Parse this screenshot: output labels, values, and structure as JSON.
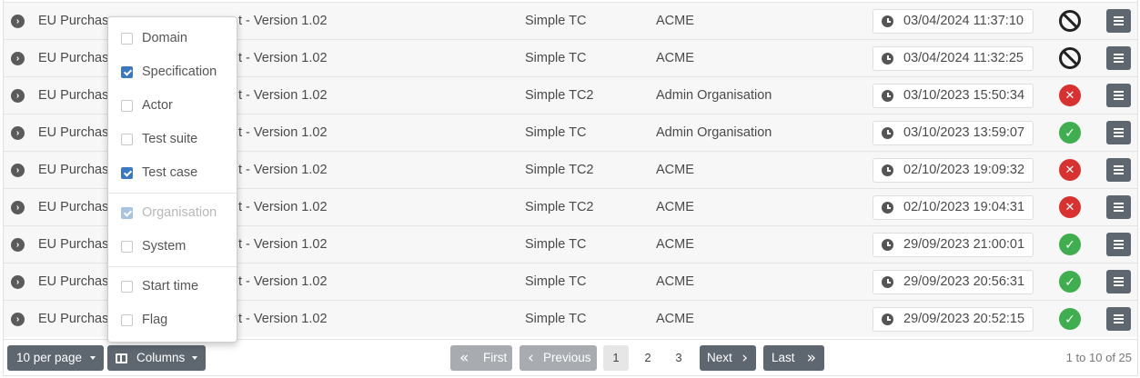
{
  "rows": [
    {
      "spec": "EU Purchase",
      "spec_suffix": "t - Version 1.02",
      "test_case": "Simple TC",
      "organisation": "ACME",
      "start_time": "03/04/2024 11:37:10",
      "status": "blocked",
      "status_icon": "ban-icon"
    },
    {
      "spec": "EU Purchase",
      "spec_suffix": "t - Version 1.02",
      "test_case": "Simple TC",
      "organisation": "ACME",
      "start_time": "03/04/2024 11:32:25",
      "status": "blocked",
      "status_icon": "ban-icon"
    },
    {
      "spec": "EU Purchase",
      "spec_suffix": "t - Version 1.02",
      "test_case": "Simple TC2",
      "organisation": "Admin Organisation",
      "start_time": "03/10/2023 15:50:34",
      "status": "failure",
      "status_icon": "x-circle-icon"
    },
    {
      "spec": "EU Purchase",
      "spec_suffix": "t - Version 1.02",
      "test_case": "Simple TC",
      "organisation": "Admin Organisation",
      "start_time": "03/10/2023 13:59:07",
      "status": "success",
      "status_icon": "check-circle-icon"
    },
    {
      "spec": "EU Purchase",
      "spec_suffix": "t - Version 1.02",
      "test_case": "Simple TC2",
      "organisation": "ACME",
      "start_time": "02/10/2023 19:09:32",
      "status": "failure",
      "status_icon": "x-circle-icon"
    },
    {
      "spec": "EU Purchase",
      "spec_suffix": "t - Version 1.02",
      "test_case": "Simple TC2",
      "organisation": "ACME",
      "start_time": "02/10/2023 19:04:31",
      "status": "failure",
      "status_icon": "x-circle-icon"
    },
    {
      "spec": "EU Purchase",
      "spec_suffix": "t - Version 1.02",
      "test_case": "Simple TC",
      "organisation": "ACME",
      "start_time": "29/09/2023 21:00:01",
      "status": "success",
      "status_icon": "check-circle-icon"
    },
    {
      "spec": "EU Purchase",
      "spec_suffix": "t - Version 1.02",
      "test_case": "Simple TC",
      "organisation": "ACME",
      "start_time": "29/09/2023 20:56:31",
      "status": "success",
      "status_icon": "check-circle-icon"
    },
    {
      "spec": "EU Purchase",
      "spec_suffix": "t - Version 1.02",
      "test_case": "Simple TC",
      "organisation": "ACME",
      "start_time": "29/09/2023 20:52:15",
      "status": "success",
      "status_icon": "check-circle-icon"
    }
  ],
  "columns_menu": {
    "items": [
      {
        "label": "Domain",
        "checked": false,
        "disabled": false
      },
      {
        "label": "Specification",
        "checked": true,
        "disabled": false
      },
      {
        "label": "Actor",
        "checked": false,
        "disabled": false
      },
      {
        "label": "Test suite",
        "checked": false,
        "disabled": false
      },
      {
        "label": "Test case",
        "checked": true,
        "disabled": false
      },
      {
        "label": "Organisation",
        "checked": true,
        "disabled": true
      },
      {
        "label": "System",
        "checked": false,
        "disabled": false
      },
      {
        "label": "Start time",
        "checked": false,
        "disabled": false
      },
      {
        "label": "Flag",
        "checked": false,
        "disabled": false
      }
    ]
  },
  "footer": {
    "per_page_label": "10 per page",
    "columns_label": "Columns",
    "first_label": "First",
    "previous_label": "Previous",
    "pages": [
      "1",
      "2",
      "3"
    ],
    "active_page": "1",
    "next_label": "Next",
    "last_label": "Last",
    "range_text": "1 to 10 of 25"
  },
  "colors": {
    "success": "#3eae4e",
    "failure": "#d83130",
    "checkbox_accent": "#3b78c2",
    "button_dark": "#5e6670"
  }
}
